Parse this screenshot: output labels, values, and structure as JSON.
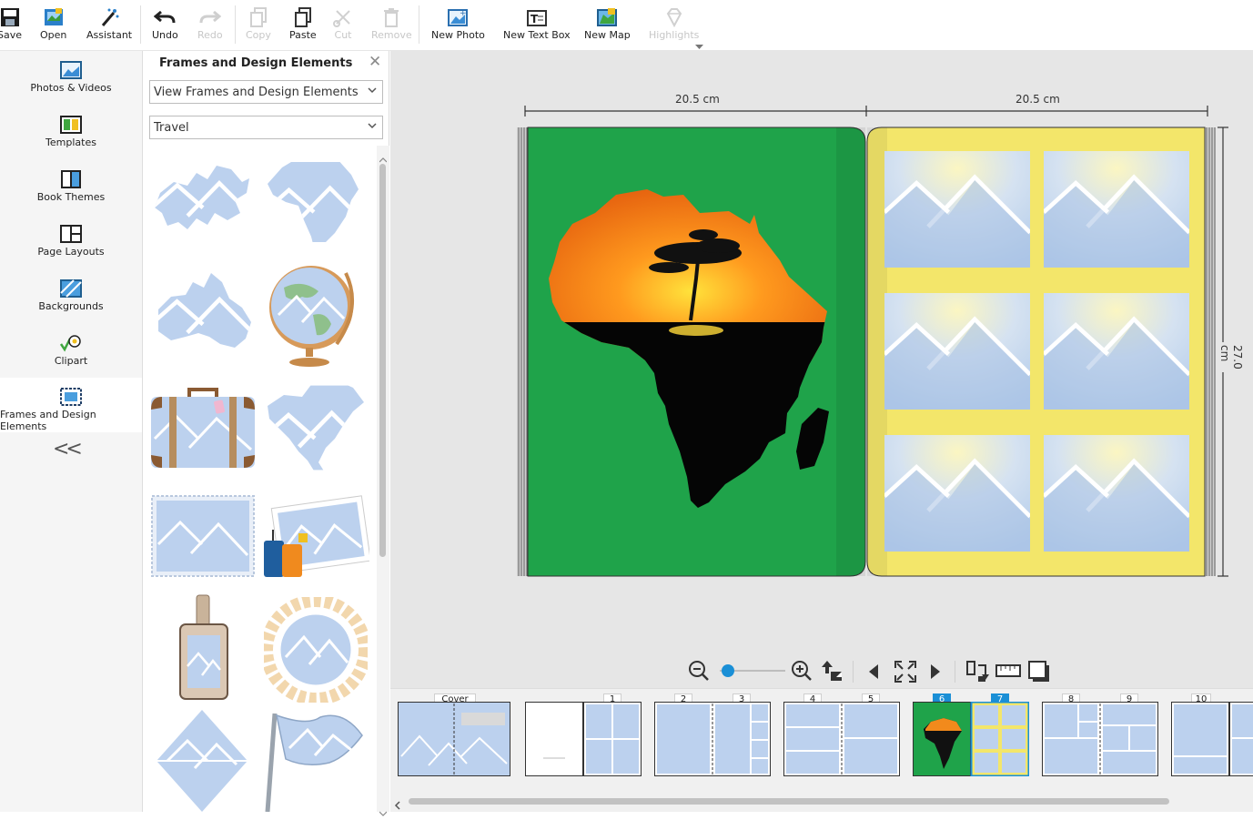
{
  "toolbar": {
    "save": "Save",
    "open": "Open",
    "assistant": "Assistant",
    "undo": "Undo",
    "redo": "Redo",
    "copy": "Copy",
    "paste": "Paste",
    "cut": "Cut",
    "remove": "Remove",
    "new_photo": "New Photo",
    "new_text_box": "New Text Box",
    "new_map": "New Map",
    "highlights": "Highlights"
  },
  "nav": {
    "photos_videos": "Photos & Videos",
    "templates": "Templates",
    "book_themes": "Book Themes",
    "page_layouts": "Page Layouts",
    "backgrounds": "Backgrounds",
    "clipart": "Clipart",
    "frames_design": "Frames and Design Elements",
    "collapse": "<<"
  },
  "panel": {
    "title": "Frames and Design Elements",
    "close": "✕",
    "view_select": "View Frames and Design Elements",
    "category_select": "Travel"
  },
  "book": {
    "width_left": "20.5 cm",
    "width_right": "20.5 cm",
    "height": "27.0 cm"
  },
  "colors": {
    "left_page": "#1fa34a",
    "right_page": "#f3e66a",
    "accent": "#1a8fd6"
  },
  "pages": {
    "cover": "Cover",
    "p1": "1",
    "p2": "2",
    "p3": "3",
    "p4": "4",
    "p5": "5",
    "p6": "6",
    "p7": "7",
    "p8": "8",
    "p9": "9",
    "p10": "10"
  }
}
